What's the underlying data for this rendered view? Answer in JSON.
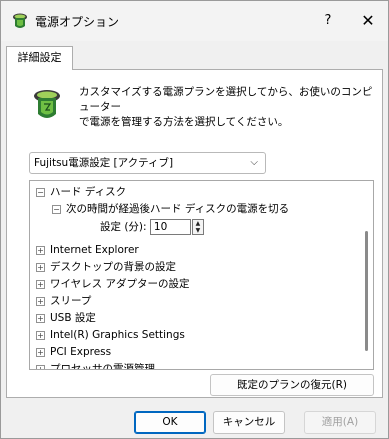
{
  "window": {
    "title": "電源オプション",
    "help": "?",
    "close": "✕"
  },
  "tab": {
    "label": "詳細設定"
  },
  "description": {
    "line1": "カスタマイズする電源プランを選択してから、お使いのコンピューター",
    "line2": "で電源を管理する方法を選択してください。"
  },
  "plan_select": {
    "value": "Fujitsu電源設定 [アクティブ]",
    "chevron": "⌵"
  },
  "tree": {
    "hard_disk": {
      "label": "ハード ディスク",
      "expander": "−"
    },
    "turn_off": {
      "label": "次の時間が経過後ハード ディスクの電源を切る",
      "expander": "−"
    },
    "setting": {
      "label": "設定 (分):",
      "value": "10",
      "up": "▲",
      "down": "▼"
    },
    "items": [
      {
        "label": "Internet Explorer",
        "expander": "+"
      },
      {
        "label": "デスクトップの背景の設定",
        "expander": "+"
      },
      {
        "label": "ワイヤレス アダプターの設定",
        "expander": "+"
      },
      {
        "label": "スリープ",
        "expander": "+"
      },
      {
        "label": "USB 設定",
        "expander": "+"
      },
      {
        "label": "Intel(R) Graphics Settings",
        "expander": "+"
      },
      {
        "label": "PCI Express",
        "expander": "+"
      },
      {
        "label": "プロセッサの電源管理",
        "expander": "+"
      }
    ]
  },
  "buttons": {
    "restore": "既定のプランの復元(R)",
    "ok": "OK",
    "cancel": "キャンセル",
    "apply": "適用(A)"
  }
}
